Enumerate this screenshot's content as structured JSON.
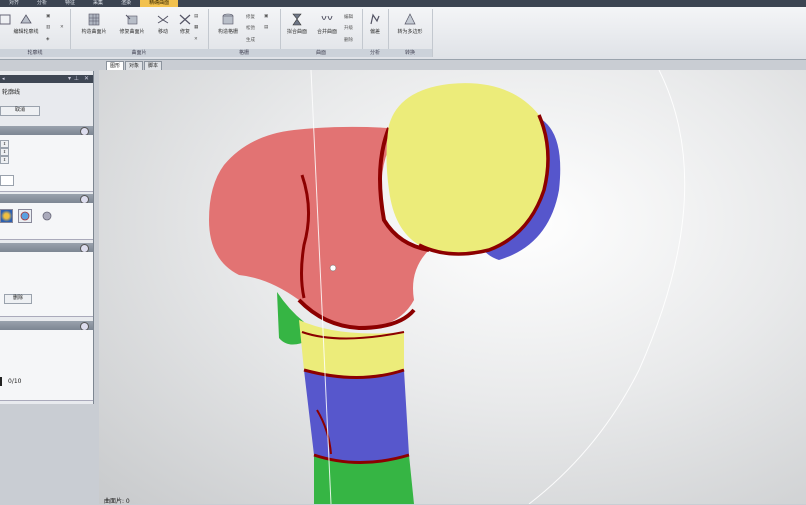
{
  "ribbon": {
    "tabs": [
      {
        "label": "对齐"
      },
      {
        "label": "分析"
      },
      {
        "label": "特征"
      },
      {
        "label": "采集"
      },
      {
        "label": "渲染"
      },
      {
        "label": "精确曲面",
        "active": true
      }
    ],
    "groups": [
      {
        "label": "轮廓线"
      },
      {
        "label": "曲面片"
      },
      {
        "label": "格栅"
      },
      {
        "label": "曲面"
      },
      {
        "label": "分析"
      },
      {
        "label": "转换"
      }
    ],
    "buttons": {
      "edit_contour": "编辑轮廓线",
      "construct_patches": "构造曲面片",
      "repair_patches": "修复曲面片",
      "shuffle": "移动",
      "shuffle2": "修复",
      "construct_grid": "构造格栅",
      "fit_surface": "拟合曲面",
      "merge_surface": "合并曲面",
      "analysis": "偏差",
      "convert": "转为多边形",
      "grid_small_1": "修复",
      "grid_small_2": "松弛",
      "grid_small_3": "生成",
      "surf_small_1": "编辑",
      "surf_small_2": "升级",
      "surf_small_3": "删除"
    }
  },
  "panel": {
    "title": "轮廓线",
    "cancel_button": "取消",
    "delete_button": "删除",
    "counter": "0/10"
  },
  "viewport": {
    "tabs": [
      {
        "label": "图形",
        "active": true
      },
      {
        "label": "对象"
      },
      {
        "label": "脚本"
      }
    ]
  },
  "status": {
    "text": "曲面片: 0"
  },
  "colors": {
    "patch_red": "#e07272",
    "patch_yellow": "#ecec7a",
    "patch_blue": "#5757cc",
    "patch_green": "#36b544",
    "contour_dark_red": "#8c0000",
    "ribbon_active_tab": "#f2c14e"
  }
}
